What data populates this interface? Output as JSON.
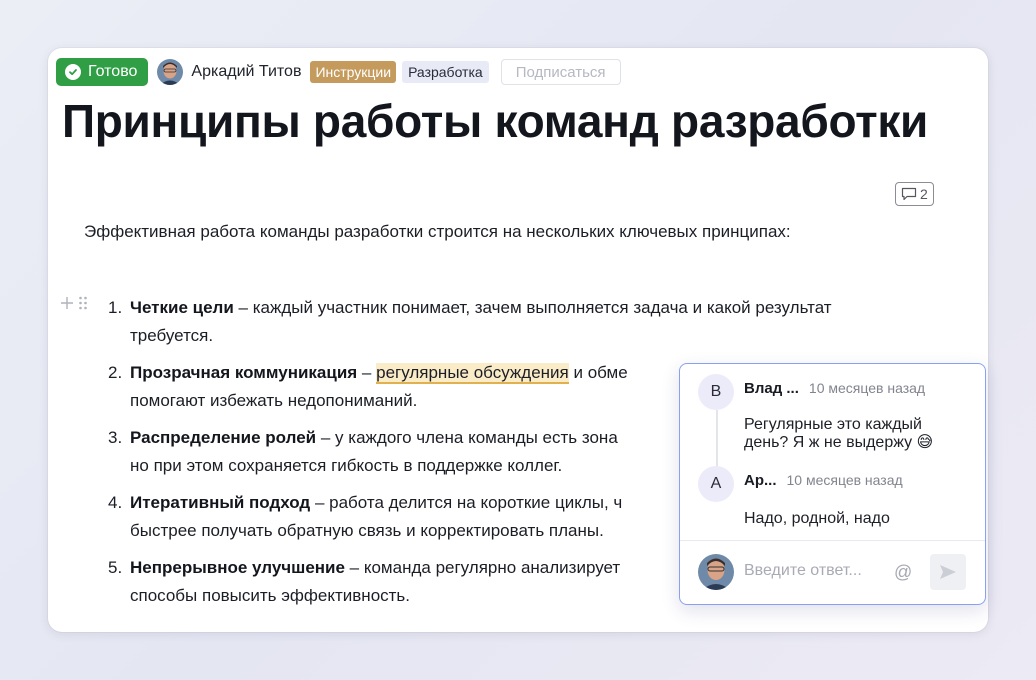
{
  "meta": {
    "status": "Готово",
    "author": "Аркадий Титов",
    "tags": [
      "Инструкции",
      "Разработка"
    ],
    "subscribe_label": "Подписаться"
  },
  "page": {
    "title": "Принципы работы команд разработки",
    "comment_count": "2",
    "intro": "Эффективная работа команды разработки строится на нескольких ключевых принципах:"
  },
  "list": [
    {
      "num": "1.",
      "title": "Четкие цели",
      "text": " – каждый участник понимает, зачем выполняется задача и какой результат требуется."
    },
    {
      "num": "2.",
      "title": "Прозрачная коммуникация",
      "pre": " – ",
      "highlight": "регулярные обсуждения",
      "text": " и обме",
      "line2": "помогают избежать недопониманий."
    },
    {
      "num": "3.",
      "title": "Распределение ролей",
      "text": " – у каждого члена команды есть зона",
      "line2": "но при этом сохраняется гибкость в поддержке коллег."
    },
    {
      "num": "4.",
      "title": "Итеративный подход",
      "text": " – работа делится на короткие циклы, ч",
      "line2": "быстрее получать обратную связь и корректировать планы."
    },
    {
      "num": "5.",
      "title": "Непрерывное улучшение",
      "text": " – команда регулярно анализирует ",
      "line2": "способы повысить эффективность."
    }
  ],
  "comments": {
    "items": [
      {
        "initial": "В",
        "name": "Влад ...",
        "time": "10 месяцев назад",
        "text": "Регулярные это каждый день? Я ж не выдержу 😅"
      },
      {
        "initial": "А",
        "name": "Ар...",
        "time": "10 месяцев назад",
        "text": "Надо, родной, надо"
      }
    ],
    "reply_placeholder": "Введите ответ...",
    "mention_symbol": "@"
  },
  "colors": {
    "status_green": "#2f9e44",
    "tag_instructions": "#c49b5d",
    "tag_dev_bg": "#e8eaf6",
    "highlight_bg": "#fbecc8",
    "popup_border": "#8aa1f2"
  }
}
